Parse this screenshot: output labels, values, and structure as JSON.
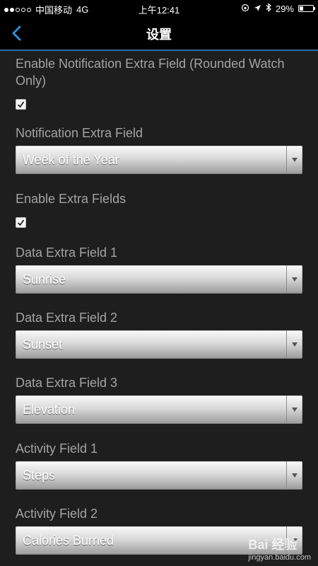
{
  "status_bar": {
    "carrier": "中国移动",
    "network": "4G",
    "time": "上午12:41",
    "battery_percent": "29%",
    "battery_level": 0.29,
    "signal_bars_filled": 2,
    "signal_bars_total": 5
  },
  "nav": {
    "title": "设置",
    "back_icon": "chevron-left-icon",
    "accent_color": "#2e6fa3"
  },
  "settings": [
    {
      "label": "Enable Notification Extra Field (Rounded Watch Only)",
      "type": "checkbox",
      "checked": true
    },
    {
      "label": "Notification Extra Field",
      "type": "select",
      "value": "Week of the Year"
    },
    {
      "label": "Enable Extra Fields",
      "type": "checkbox",
      "checked": true
    },
    {
      "label": "Data Extra Field 1",
      "type": "select",
      "value": "Sunrise"
    },
    {
      "label": "Data Extra Field 2",
      "type": "select",
      "value": "Sunset"
    },
    {
      "label": "Data Extra Field 3",
      "type": "select",
      "value": "Elevation"
    },
    {
      "label": "Activity Field 1",
      "type": "select",
      "value": "Steps"
    },
    {
      "label": "Activity Field 2",
      "type": "select",
      "value": "Calories Burned"
    }
  ],
  "watermark": {
    "line1": "Bai 经验",
    "line2": "jingyan.baidu.com"
  }
}
